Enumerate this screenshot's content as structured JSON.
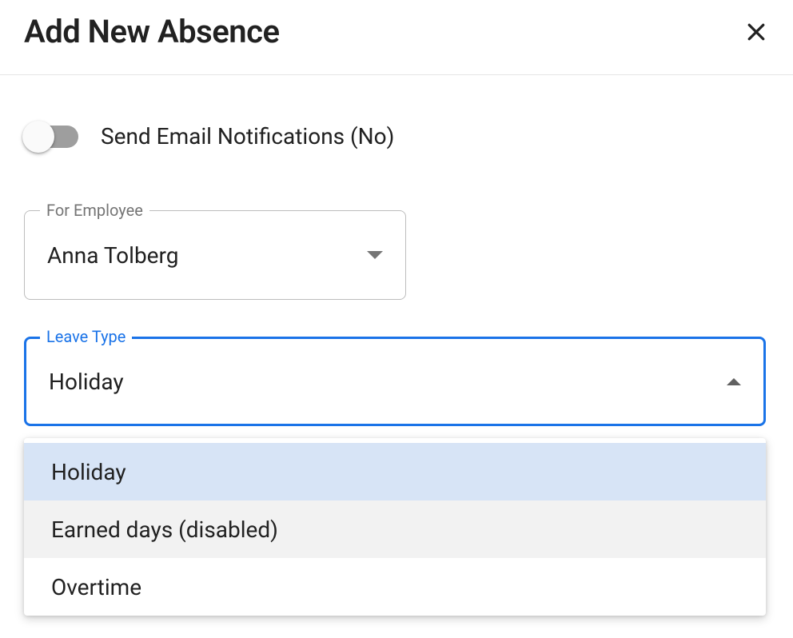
{
  "header": {
    "title": "Add New Absence"
  },
  "notifications": {
    "label": "Send Email Notifications (No)",
    "enabled": false
  },
  "employee": {
    "legend": "For Employee",
    "value": "Anna Tolberg"
  },
  "leaveType": {
    "legend": "Leave Type",
    "value": "Holiday",
    "options": [
      {
        "label": "Holiday",
        "state": "selected"
      },
      {
        "label": "Earned days (disabled)",
        "state": "disabled"
      },
      {
        "label": "Overtime",
        "state": "normal"
      }
    ]
  }
}
